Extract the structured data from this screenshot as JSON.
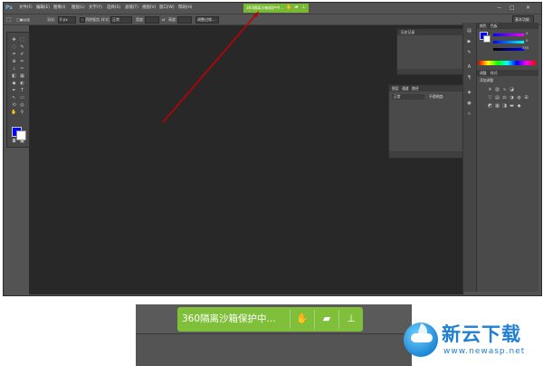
{
  "app": {
    "logo": "Ps",
    "menu": [
      "文件(F)",
      "编辑(E)",
      "图像(I)",
      "图层(L)",
      "文字(Y)",
      "选择(S)",
      "滤镜(T)",
      "视图(V)",
      "窗口(W)",
      "帮助(H)"
    ],
    "essentials_label": "基本功能",
    "window_controls": [
      "−",
      "□",
      "✕"
    ]
  },
  "sandbox_badge": {
    "text": "360隔离沙箱保护中...",
    "color": "#7fbf3a",
    "icons": [
      "hand-icon",
      "folder-icon",
      "pin-icon"
    ]
  },
  "options_bar": {
    "feather_label": "羽化:",
    "feather_value": "0 px",
    "antialias_label": "消除锯齿",
    "style_label": "样式:",
    "style_value": "正常",
    "width_label": "宽度:",
    "height_label": "高度:",
    "refine_label": "调整边缘..."
  },
  "panels": {
    "history_title": "历史记录",
    "layers_tabs": [
      "图层",
      "通道",
      "路径"
    ],
    "layers_mode": "正常",
    "layers_opacity": "不透明度:",
    "color_tabs": [
      "颜色",
      "色板"
    ],
    "color_r": "0",
    "color_g": "0",
    "color_b": "255",
    "adjust_tabs": [
      "调整",
      "样式"
    ],
    "adjust_title": "添加调整"
  },
  "colors": {
    "foreground": "#0000ff",
    "background": "#ffffff",
    "arrow": "#c00000"
  },
  "watermark": {
    "brand": "新云下载",
    "url": "www.newasp.net"
  }
}
